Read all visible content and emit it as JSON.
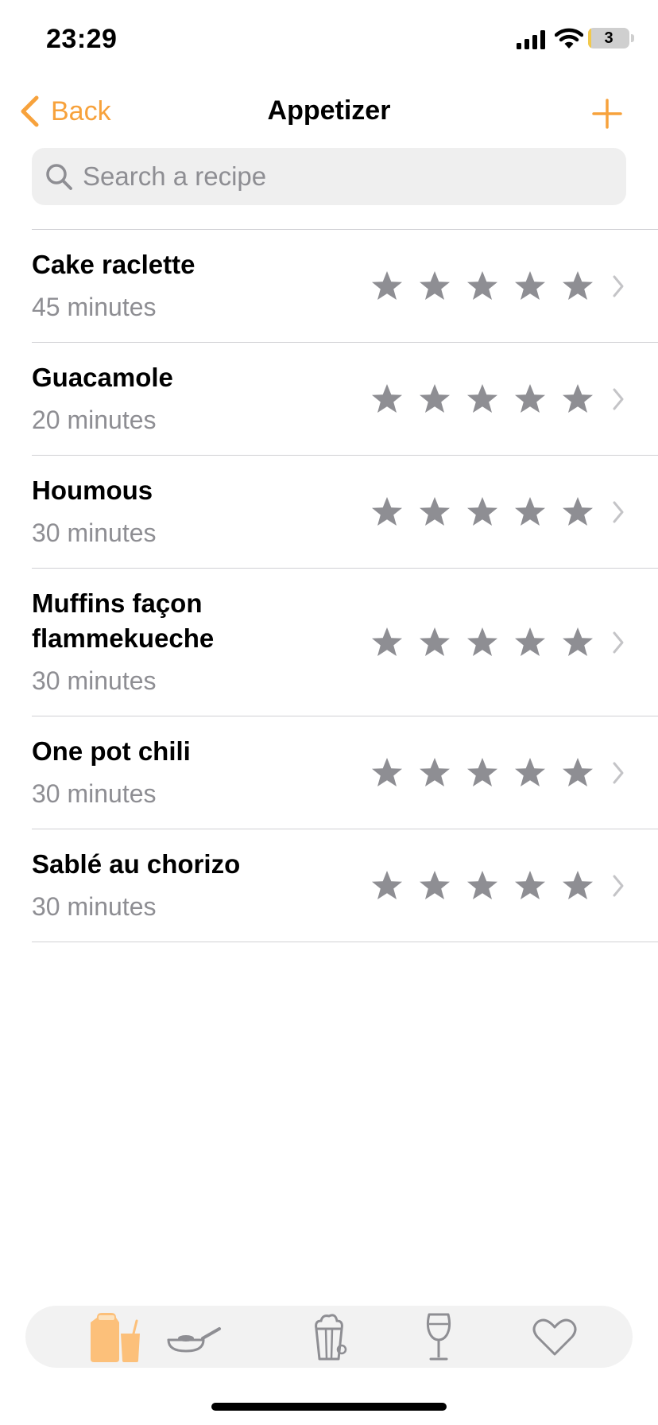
{
  "status_bar": {
    "time": "23:29",
    "battery_level": "3",
    "battery_fraction": 0.03,
    "icons": [
      "signal-icon",
      "wifi-icon",
      "battery-icon"
    ]
  },
  "nav": {
    "back_label": "Back",
    "title": "Appetizer",
    "add_icon": "plus-icon"
  },
  "search": {
    "placeholder": "Search a recipe",
    "value": ""
  },
  "recipes": [
    {
      "name": "Cake raclette",
      "time": "45 minutes",
      "rating": 0,
      "max_rating": 5
    },
    {
      "name": "Guacamole",
      "time": "20 minutes",
      "rating": 0,
      "max_rating": 5
    },
    {
      "name": "Houmous",
      "time": "30 minutes",
      "rating": 0,
      "max_rating": 5
    },
    {
      "name": "Muffins façon flammekueche",
      "time": "30 minutes",
      "rating": 0,
      "max_rating": 5
    },
    {
      "name": "One pot chili",
      "time": "30 minutes",
      "rating": 0,
      "max_rating": 5
    },
    {
      "name": "Sablé au chorizo",
      "time": "30 minutes",
      "rating": 0,
      "max_rating": 5
    }
  ],
  "tab_bar": {
    "tabs": [
      {
        "icon": "appetizer-drinks-icon",
        "selected": true
      },
      {
        "icon": "frying-pan-icon",
        "selected": false
      },
      {
        "icon": "popcorn-icon",
        "selected": false
      },
      {
        "icon": "wine-glass-icon",
        "selected": false
      },
      {
        "icon": "heart-icon",
        "selected": false
      }
    ]
  },
  "colors": {
    "accent": "#f7a23c",
    "accent_light": "#fcc07a",
    "star_gray": "#8e8e93",
    "secondary_text": "#8e8e93",
    "tab_icon_gray": "#8e8e93",
    "search_bg": "#efefef",
    "tab_bar_bg": "#f2f2f2",
    "battery_fill": "#f2c94c"
  }
}
